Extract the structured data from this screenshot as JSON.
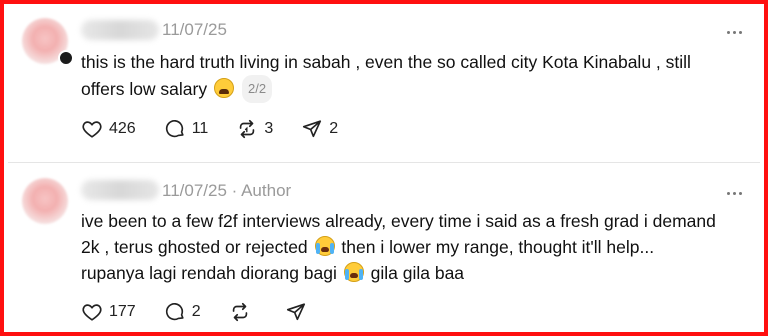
{
  "posts": [
    {
      "date": "11/07/25",
      "author_tag": "",
      "lines": [
        "this is the hard truth living in sabah , even the so called city Kota Kinabalu , still",
        "offers low salary"
      ],
      "thread_position": "2/2",
      "likes": "426",
      "replies": "11",
      "reposts": "3",
      "shares": "2"
    },
    {
      "date": "11/07/25",
      "author_tag": "Author",
      "lines": [
        "ive been to a few f2f interviews already, every time i said as a fresh grad i demand",
        "2k , terus ghosted or rejected",
        " then i lower my range, thought it'll help...",
        "rupanya lagi rendah diorang bagi",
        " gila gila baa"
      ],
      "likes": "177",
      "replies": "2"
    }
  ],
  "icons": {
    "like": "heart-icon",
    "reply": "comment-icon",
    "repost": "repost-icon",
    "share": "send-icon",
    "more": "more-icon"
  },
  "colors": {
    "frame_border": "#ff1010",
    "meta_text": "#9a9a9a"
  }
}
